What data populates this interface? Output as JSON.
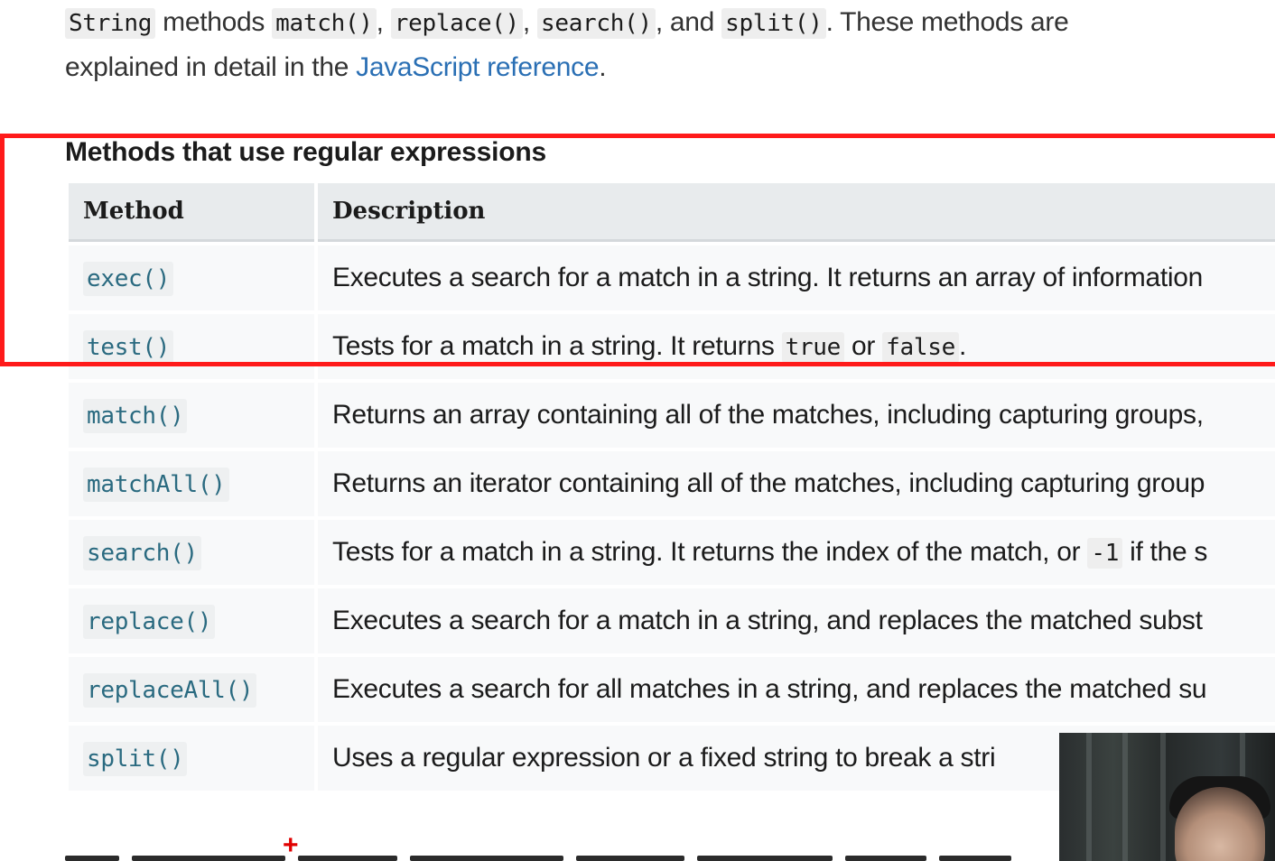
{
  "intro": {
    "line1": {
      "code1": "String",
      "t1": " methods ",
      "code2": "match()",
      "t2": ", ",
      "code3": "replace()",
      "t3": ", ",
      "code4": "search()",
      "t4": ", and ",
      "code5": "split()",
      "t5": ". These methods are"
    },
    "line2": {
      "t1": "explained in detail in the ",
      "link": "JavaScript reference",
      "t2": "."
    }
  },
  "table": {
    "caption": "Methods that use regular expressions",
    "headers": {
      "method": "Method",
      "description": "Description"
    },
    "rows": [
      {
        "method": "exec()",
        "description": "Executes a search for a match in a string. It returns an array of information"
      },
      {
        "method": "test()",
        "description": {
          "pre": "Tests for a match in a string. It returns ",
          "code1": "true",
          "mid": " or ",
          "code2": "false",
          "post": "."
        }
      },
      {
        "method": "match()",
        "description": "Returns an array containing all of the matches, including capturing groups,"
      },
      {
        "method": "matchAll()",
        "description": "Returns an iterator containing all of the matches, including capturing group"
      },
      {
        "method": "search()",
        "description": {
          "pre": "Tests for a match in a string. It returns the index of the match, or ",
          "code1": "-1",
          "post": " if the s"
        }
      },
      {
        "method": "replace()",
        "description": "Executes a search for a match in a string, and replaces the matched subst"
      },
      {
        "method": "replaceAll()",
        "description": "Executes a search for all matches in a string, and replaces the matched su"
      },
      {
        "method": "split()",
        "description": "Uses a regular expression or a fixed string to break a stri"
      }
    ]
  },
  "colors": {
    "highlight_border": "#ff1a1a",
    "link": "#2a6fb4",
    "method_code": "#2a6a80",
    "cursor": "#e00000"
  },
  "cursor": {
    "glyph": "+"
  }
}
